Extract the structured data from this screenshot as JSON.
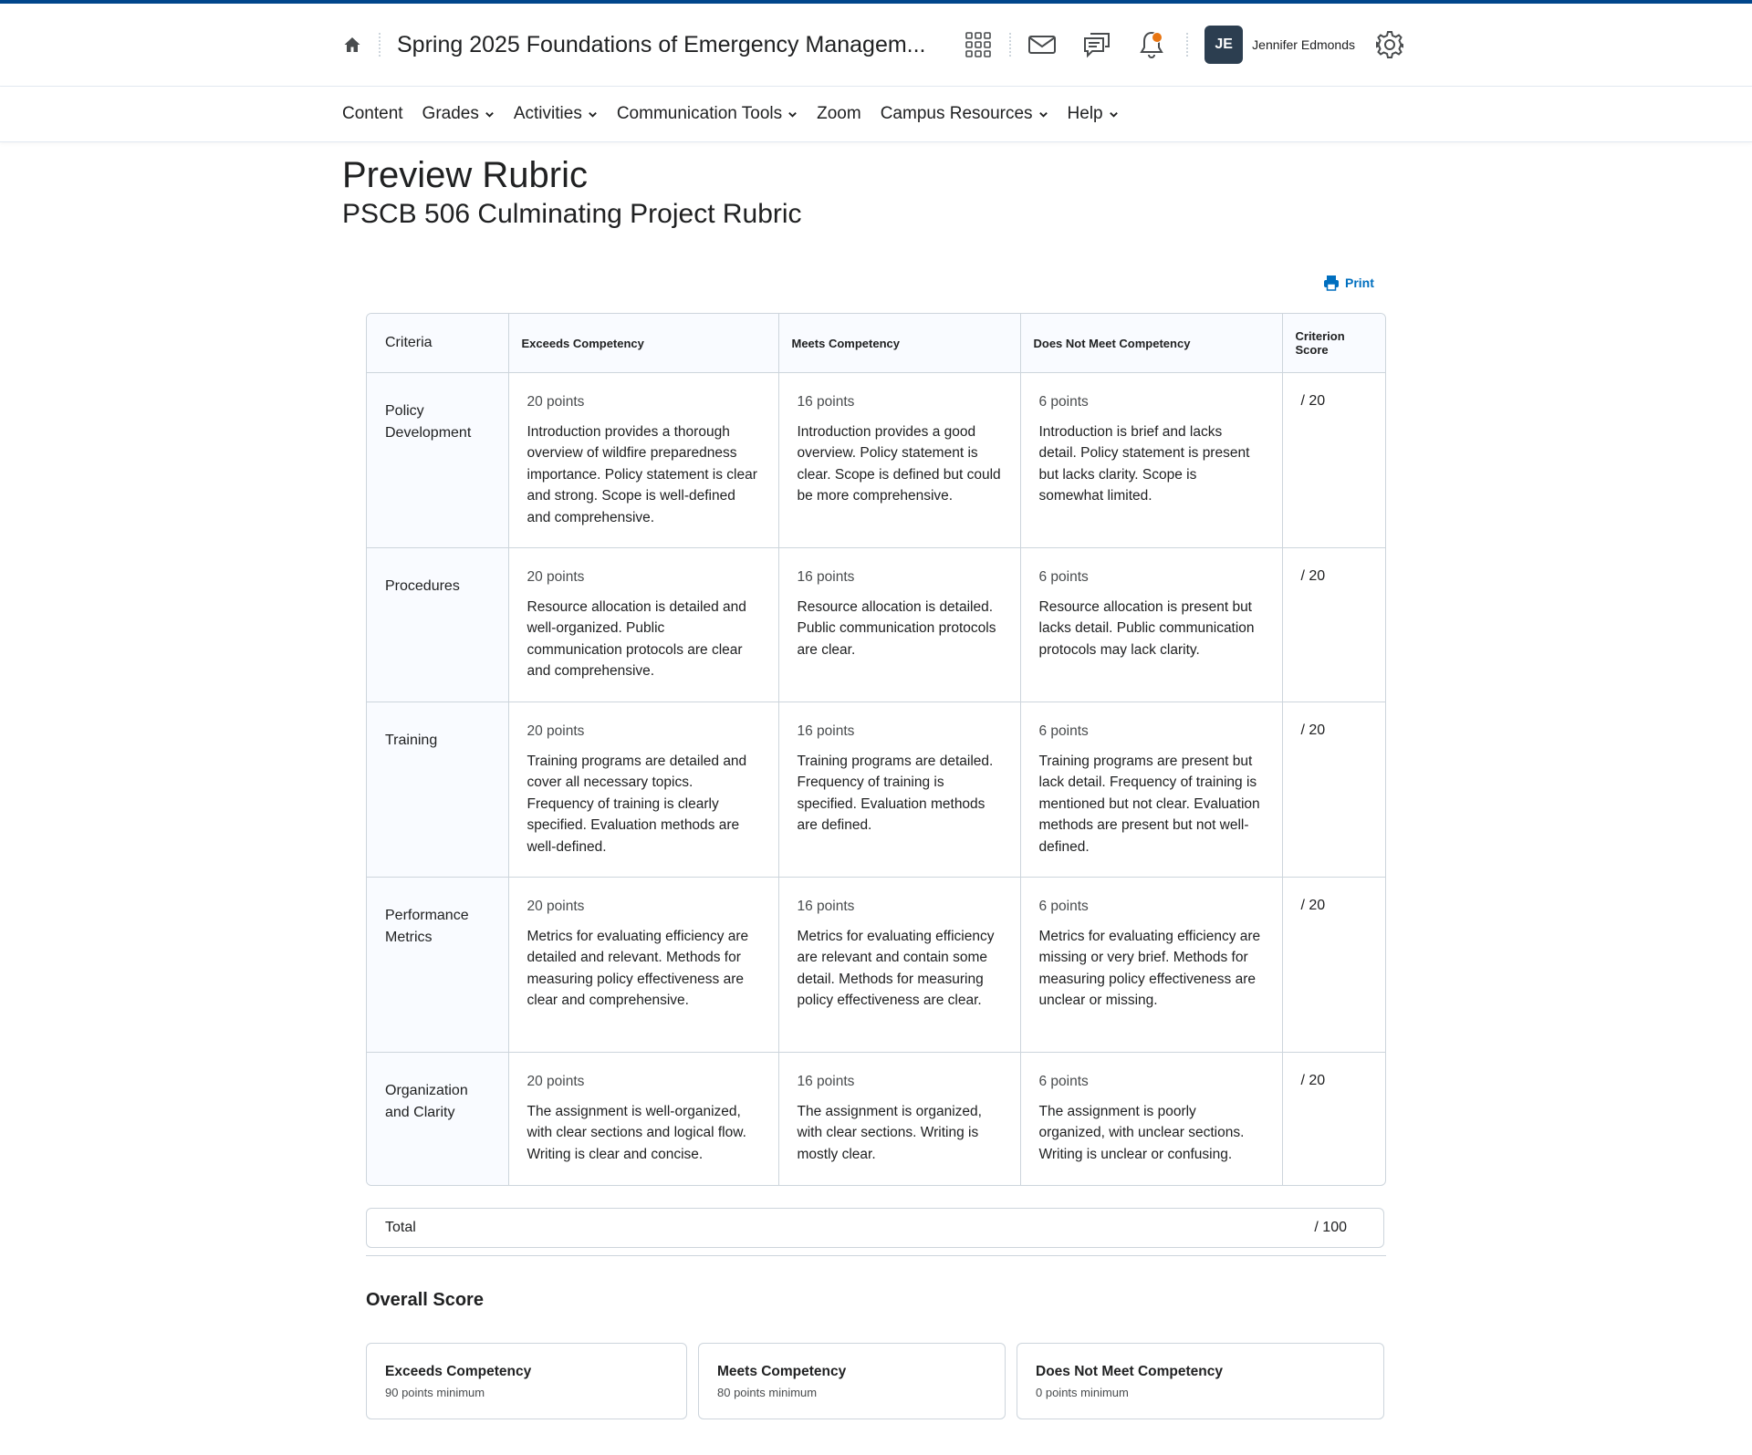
{
  "header": {
    "course_title": "Spring 2025 Foundations of Emergency Managem...",
    "avatar_initials": "JE",
    "user_name": "Jennifer Edmonds",
    "accent_color": "#00468b",
    "notification_color": "#e87511",
    "icons": [
      "home-icon",
      "app-grid-icon",
      "mail-icon",
      "chat-icon",
      "bell-icon",
      "gear-icon"
    ]
  },
  "nav": {
    "items": [
      {
        "label": "Content",
        "dropdown": false
      },
      {
        "label": "Grades",
        "dropdown": true
      },
      {
        "label": "Activities",
        "dropdown": true
      },
      {
        "label": "Communication Tools",
        "dropdown": true
      },
      {
        "label": "Zoom",
        "dropdown": false
      },
      {
        "label": "Campus Resources",
        "dropdown": true
      },
      {
        "label": "Help",
        "dropdown": true
      }
    ]
  },
  "page": {
    "title": "Preview Rubric",
    "subtitle": "PSCB 506 Culminating Project Rubric",
    "print_label": "Print",
    "link_color": "#006fbf"
  },
  "rubric": {
    "headers": [
      "Criteria",
      "Exceeds Competency",
      "Meets Competency",
      "Does Not Meet Competency",
      "Criterion Score"
    ],
    "rows": [
      {
        "criterion": "Policy Development",
        "levels": [
          {
            "points": "20 points",
            "text": "Introduction provides a thorough overview of wildfire preparedness importance. Policy statement is clear and strong. Scope is well-defined and comprehensive."
          },
          {
            "points": "16 points",
            "text": "Introduction provides a good overview. Policy statement is clear. Scope is defined but could be more comprehensive."
          },
          {
            "points": "6 points",
            "text": "Introduction is brief and lacks detail. Policy statement is present but lacks clarity. Scope is somewhat limited."
          }
        ],
        "score": "/ 20"
      },
      {
        "criterion": "Procedures",
        "levels": [
          {
            "points": "20 points",
            "text": "Resource allocation is detailed and well-organized. Public communication protocols are clear and comprehensive."
          },
          {
            "points": "16 points",
            "text": "Resource allocation is detailed. Public communication protocols are clear."
          },
          {
            "points": "6 points",
            "text": "Resource allocation is present but lacks detail. Public communication protocols may lack clarity."
          }
        ],
        "score": "/ 20"
      },
      {
        "criterion": "Training",
        "levels": [
          {
            "points": "20 points",
            "text": "Training programs are detailed and cover all necessary topics. Frequency of training is clearly specified. Evaluation methods are well-defined."
          },
          {
            "points": "16 points",
            "text": "Training programs are detailed. Frequency of training is specified. Evaluation methods are defined."
          },
          {
            "points": "6 points",
            "text": "Training programs are present but lack detail. Frequency of training is mentioned but not clear. Evaluation methods are present but not well-defined."
          }
        ],
        "score": "/ 20"
      },
      {
        "criterion": "Performance Metrics",
        "levels": [
          {
            "points": "20 points",
            "text": "Metrics for evaluating efficiency are detailed and relevant. Methods for measuring policy effectiveness are clear and comprehensive."
          },
          {
            "points": "16 points",
            "text": "Metrics for evaluating efficiency are relevant and contain some detail. Methods for measuring policy effectiveness are clear."
          },
          {
            "points": "6 points",
            "text": "Metrics for evaluating efficiency are missing or very brief. Methods for measuring policy effectiveness are unclear or missing."
          }
        ],
        "score": "/ 20"
      },
      {
        "criterion": "Organization and Clarity",
        "levels": [
          {
            "points": "20 points",
            "text": "The assignment is well-organized, with clear sections and logical flow. Writing is clear and concise."
          },
          {
            "points": "16 points",
            "text": "The assignment is organized, with clear sections. Writing is mostly clear."
          },
          {
            "points": "6 points",
            "text": "The assignment is poorly organized, with unclear sections. Writing is unclear or confusing."
          }
        ],
        "score": "/ 20"
      }
    ],
    "total_label": "Total",
    "total_value": "/ 100"
  },
  "overall": {
    "title": "Overall Score",
    "cards": [
      {
        "name": "Exceeds Competency",
        "min": "90 points minimum"
      },
      {
        "name": "Meets Competency",
        "min": "80 points minimum"
      },
      {
        "name": "Does Not Meet Competency",
        "min": "0 points minimum"
      }
    ]
  }
}
